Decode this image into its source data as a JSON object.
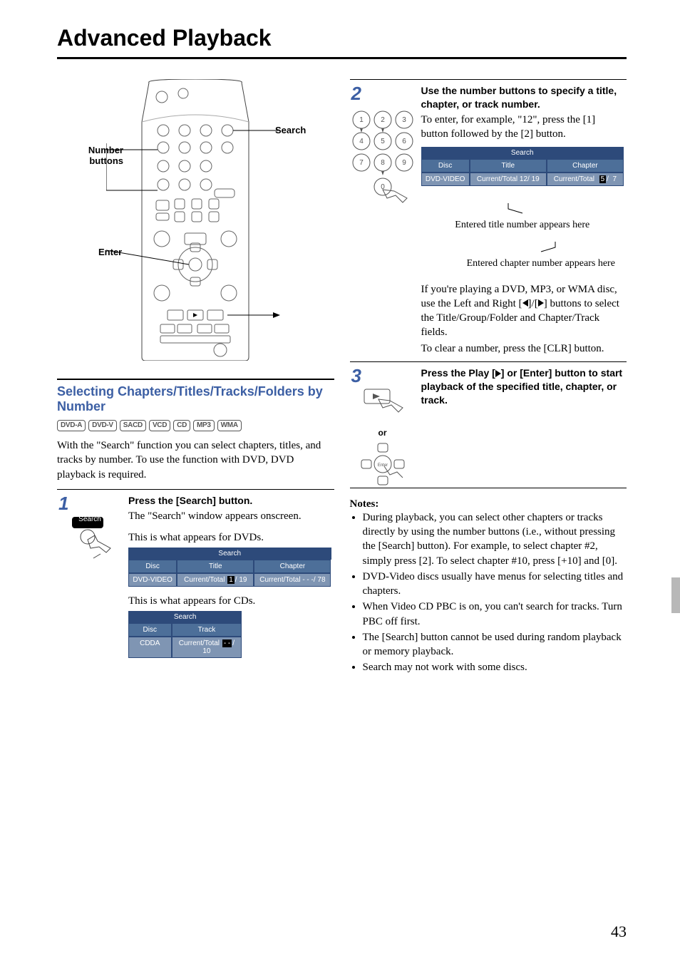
{
  "page_title": "Advanced Playback",
  "page_number": "43",
  "remote_labels": {
    "number_buttons": "Number buttons",
    "search": "Search",
    "enter": "Enter"
  },
  "section_heading": "Selecting Chapters/Titles/Tracks/Folders by Number",
  "badges": [
    "DVD-A",
    "DVD-V",
    "SACD",
    "VCD",
    "CD",
    "MP3",
    "WMA"
  ],
  "intro": "With the \"Search\" function you can select chapters, titles, and tracks by number. To use the function with DVD, DVD playback is required.",
  "step1": {
    "title": "Press the [Search] button.",
    "body": "The \"Search\" window appears onscreen.",
    "caption_dvd": "This is what appears for DVDs.",
    "caption_cd": "This is what appears for CDs.",
    "button_label": "Search",
    "dvd_panel": {
      "header": "Search",
      "cols": [
        "Disc",
        "Title",
        "Chapter"
      ],
      "disc": "DVD-VIDEO",
      "title_val": "Current/Total  1/ 19",
      "title_hl": "1",
      "chapter_val": "Current/Total - - -/ 78"
    },
    "cd_panel": {
      "header": "Search",
      "cols": [
        "Disc",
        "Track"
      ],
      "disc": "CDDA",
      "track_val": "Current/Total - -/ 10",
      "track_hl": "- -"
    }
  },
  "step2": {
    "title": "Use the number buttons to specify a title, chapter, or track number.",
    "body": "To enter, for example, \"12\", press the [1] button followed by the [2] button.",
    "panel": {
      "header": "Search",
      "cols": [
        "Disc",
        "Title",
        "Chapter"
      ],
      "disc": "DVD-VIDEO",
      "title_val": "Current/Total 12/ 19",
      "chapter_val": "Current/Total   5/  7",
      "chapter_hl": "5"
    },
    "callout_title": "Entered title number appears here",
    "callout_chapter": "Entered chapter number appears here",
    "tail1": "If you're playing a DVD, MP3, or WMA disc, use the Left and Right [",
    "tail2": "]/[",
    "tail3": "] buttons to select the Title/Group/Folder and Chapter/Track fields.",
    "tail_clr": "To clear a number, press the [CLR] button."
  },
  "step3": {
    "title_a": "Press the Play [",
    "title_b": "] or [Enter] button to start playback of the specified title, chapter, or track.",
    "or": "or"
  },
  "notes_heading": "Notes:",
  "notes": [
    "During playback, you can select other chapters or tracks directly by using the number buttons (i.e., without pressing the [Search] button). For example, to select chapter #2, simply press [2]. To select chapter #10, press [+10] and [0].",
    "DVD-Video discs usually have menus for selecting titles and chapters.",
    "When Video CD PBC is on, you can't search for tracks. Turn PBC off first.",
    "The [Search] button cannot be used during random playback or memory playback.",
    "Search may not work with some discs."
  ]
}
